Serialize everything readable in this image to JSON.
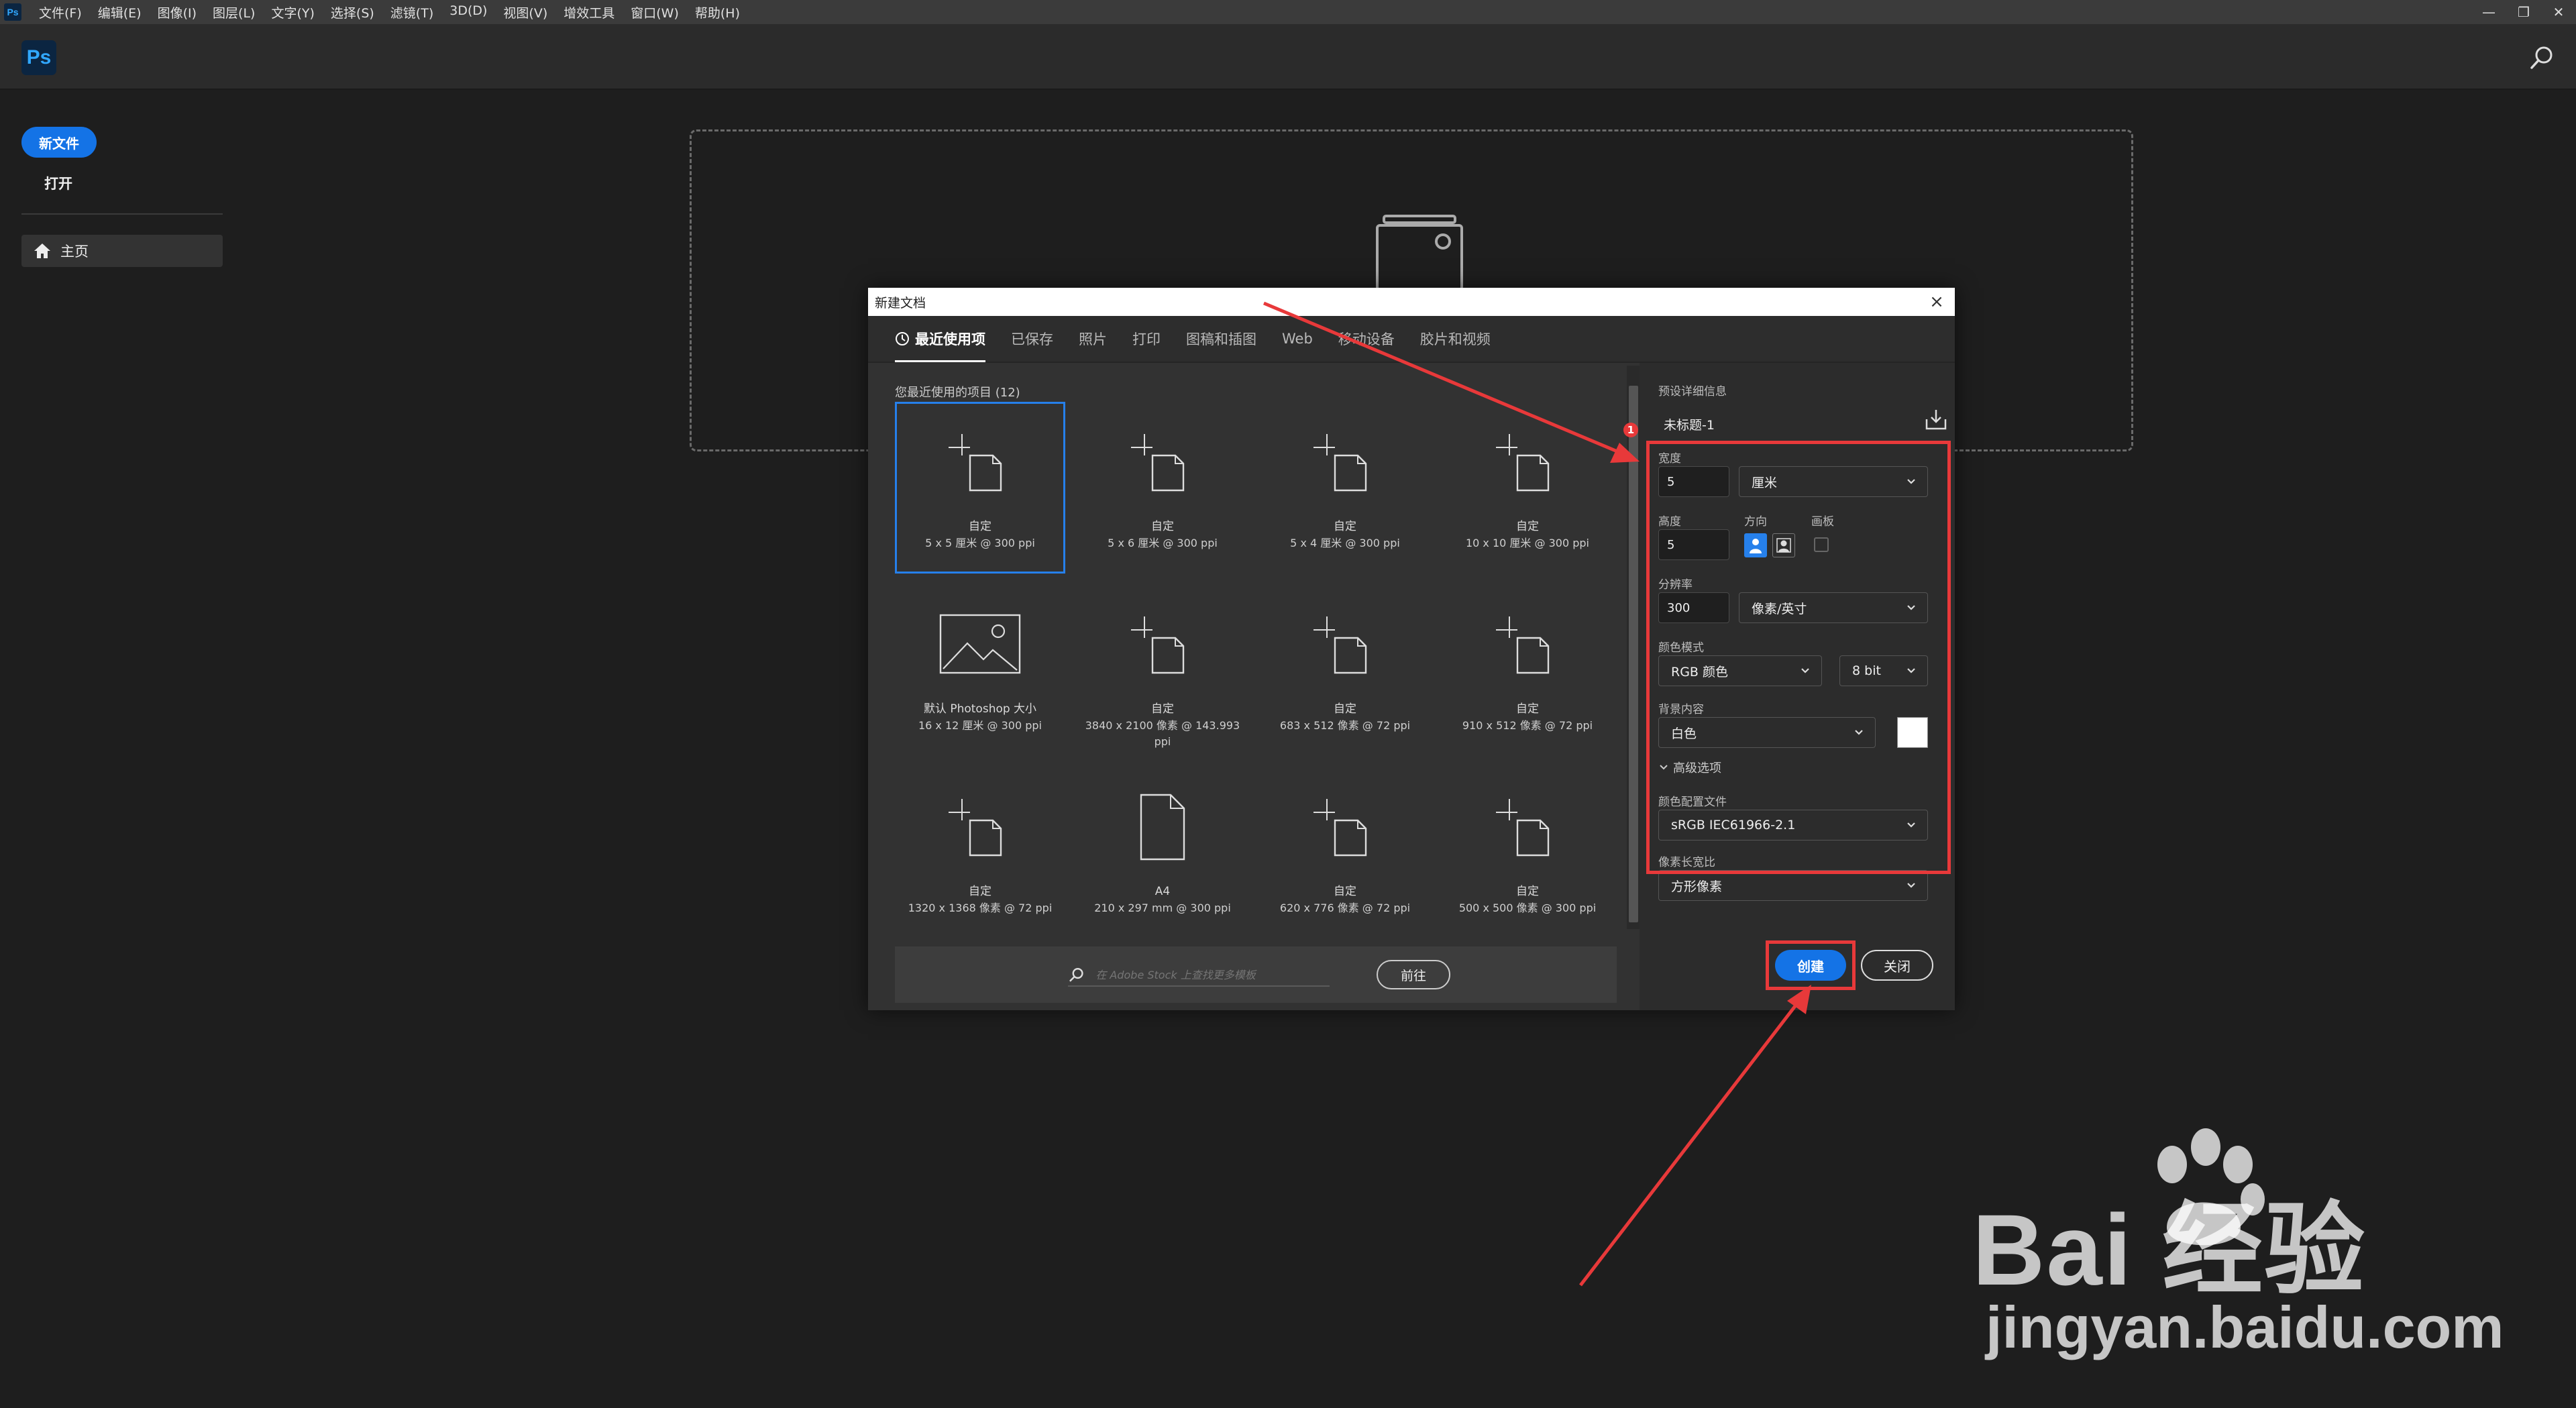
{
  "menubar": {
    "app_icon": "Ps",
    "items": [
      "文件(F)",
      "编辑(E)",
      "图像(I)",
      "图层(L)",
      "文字(Y)",
      "选择(S)",
      "滤镜(T)",
      "3D(D)",
      "视图(V)",
      "增效工具",
      "窗口(W)",
      "帮助(H)"
    ],
    "window_controls": [
      "—",
      "❐",
      "✕"
    ]
  },
  "appbar": {
    "logo": "Ps",
    "search_icon": "search-icon"
  },
  "left_panel": {
    "new_file": "新文件",
    "open": "打开",
    "home": "主页"
  },
  "dialog": {
    "title": "新建文档",
    "close_glyph": "×",
    "tabs": [
      "最近使用项",
      "已保存",
      "照片",
      "打印",
      "图稿和插图",
      "Web",
      "移动设备",
      "胶片和视频"
    ],
    "section_title": "您最近使用的项目 (12)",
    "presets": [
      {
        "name": "自定",
        "dims": "5 x 5 厘米 @ 300 ppi",
        "icon": "custom-doc-icon"
      },
      {
        "name": "自定",
        "dims": "5 x 6 厘米 @ 300 ppi",
        "icon": "custom-doc-icon"
      },
      {
        "name": "自定",
        "dims": "5 x 4 厘米 @ 300 ppi",
        "icon": "custom-doc-icon"
      },
      {
        "name": "自定",
        "dims": "10 x 10 厘米 @ 300 ppi",
        "icon": "custom-doc-icon"
      },
      {
        "name": "默认 Photoshop 大小",
        "dims": "16 x 12 厘米 @ 300 ppi",
        "icon": "image-icon"
      },
      {
        "name": "自定",
        "dims": "3840 x 2100 像素 @ 143.993 ppi",
        "icon": "custom-doc-icon"
      },
      {
        "name": "自定",
        "dims": "683 x 512 像素 @ 72 ppi",
        "icon": "custom-doc-icon"
      },
      {
        "name": "自定",
        "dims": "910 x 512 像素 @ 72 ppi",
        "icon": "custom-doc-icon"
      },
      {
        "name": "自定",
        "dims": "1320 x 1368 像素 @ 72 ppi",
        "icon": "custom-doc-icon"
      },
      {
        "name": "A4",
        "dims": "210 x 297 mm @ 300 ppi",
        "icon": "page-icon"
      },
      {
        "name": "自定",
        "dims": "620 x 776 像素 @ 72 ppi",
        "icon": "custom-doc-icon"
      },
      {
        "name": "自定",
        "dims": "500 x 500 像素 @ 300 ppi",
        "icon": "custom-doc-icon"
      }
    ],
    "stock_placeholder": "在 Adobe Stock 上查找更多模板",
    "goto": "前往",
    "details": {
      "header": "预设详细信息",
      "doc_name": "未标题-1",
      "width_label": "宽度",
      "width_value": "5",
      "width_unit": "厘米",
      "height_label": "高度",
      "height_value": "5",
      "orientation_label": "方向",
      "artboard_label": "画板",
      "resolution_label": "分辨率",
      "resolution_value": "300",
      "resolution_unit": "像素/英寸",
      "color_mode_label": "颜色模式",
      "color_mode": "RGB 颜色",
      "bit_depth": "8 bit",
      "background_label": "背景内容",
      "background": "白色",
      "advanced": "高级选项",
      "profile_label": "颜色配置文件",
      "profile": "sRGB IEC61966-2.1",
      "pixel_aspect_label": "像素长宽比",
      "pixel_aspect": "方形像素"
    },
    "create": "创建",
    "close": "关闭"
  },
  "annotation": {
    "badge": "1",
    "color": "#e8393a"
  },
  "watermark": {
    "brand": "Bai  经验",
    "url": "jingyan.baidu.com"
  },
  "colors": {
    "accent": "#1473e6",
    "selection": "#2680eb",
    "annotation": "#e8393a"
  }
}
